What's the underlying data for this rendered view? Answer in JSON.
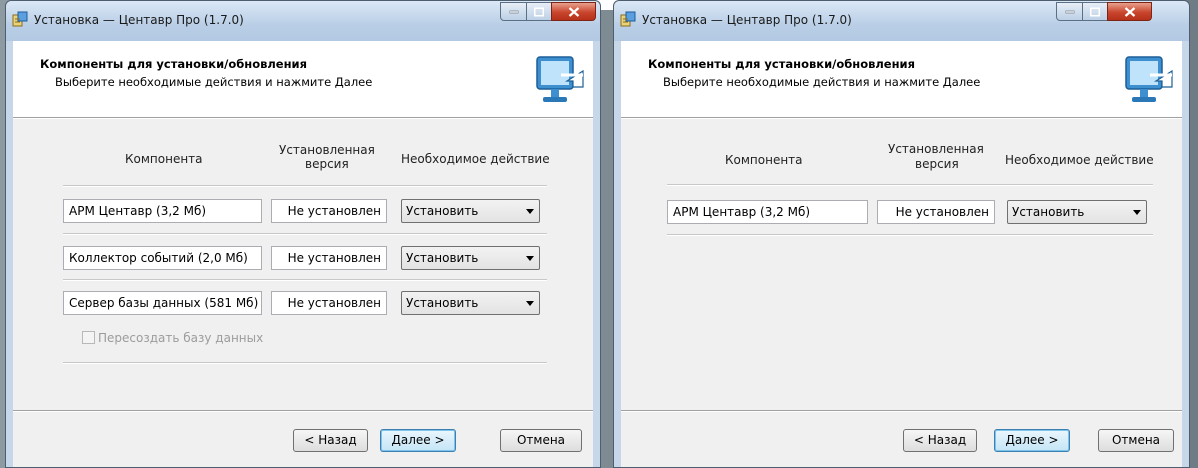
{
  "windows": [
    {
      "title": "Установка — Центавр Про (1.7.0)",
      "header_title": "Компоненты для установки/обновления",
      "header_subtitle": "Выберите необходимые действия и нажмите Далее",
      "columns": {
        "component": "Компонента",
        "installed_line1": "Установленная",
        "installed_line2": "версия",
        "action": "Необходимое действие"
      },
      "rows": [
        {
          "component": "АРМ Центавр (3,2 Мб)",
          "installed": "Не установлен",
          "action": "Установить"
        },
        {
          "component": "Коллектор событий (2,0 Мб)",
          "installed": "Не установлен",
          "action": "Установить"
        },
        {
          "component": "Сервер базы данных (581 Мб)",
          "installed": "Не установлен",
          "action": "Установить"
        }
      ],
      "recreate_db_label": "Пересоздать базу данных",
      "buttons": {
        "back": "< Назад",
        "next": "Далее >",
        "cancel": "Отмена"
      }
    },
    {
      "title": "Установка — Центавр Про (1.7.0)",
      "header_title": "Компоненты для установки/обновления",
      "header_subtitle": "Выберите необходимые действия и нажмите Далее",
      "columns": {
        "component": "Компонента",
        "installed_line1": "Установленная",
        "installed_line2": "версия",
        "action": "Необходимое действие"
      },
      "rows": [
        {
          "component": "АРМ Центавр (3,2 Мб)",
          "installed": "Не установлен",
          "action": "Установить"
        }
      ],
      "buttons": {
        "back": "< Назад",
        "next": "Далее >",
        "cancel": "Отмена"
      }
    }
  ],
  "colors": {
    "title_bar": "#b9cee6",
    "close_button": "#c9452c",
    "default_button_border": "#3c7fb1"
  },
  "icons": [
    "installer-app-icon",
    "minimize-icon",
    "maximize-icon",
    "close-icon",
    "monitor-arrow-icon",
    "dropdown-arrow-icon"
  ]
}
